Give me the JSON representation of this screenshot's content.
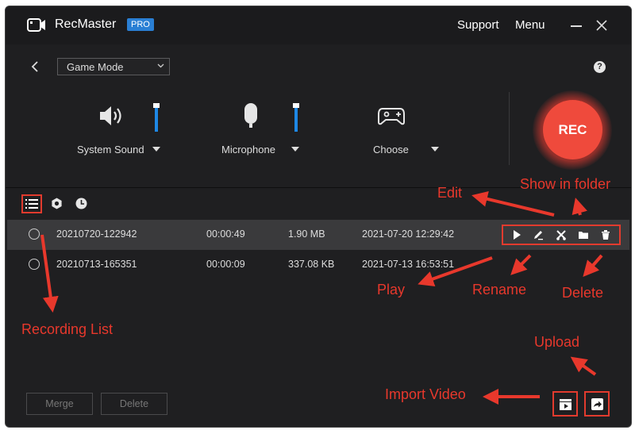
{
  "app": {
    "name": "RecMaster",
    "badge": "PRO"
  },
  "titlebar": {
    "support": "Support",
    "menu": "Menu"
  },
  "mode": {
    "selected": "Game Mode"
  },
  "sources": {
    "system_sound": "System Sound",
    "microphone": "Microphone",
    "choose": "Choose"
  },
  "rec_label": "REC",
  "recordings": [
    {
      "name": "20210720-122942",
      "duration": "00:00:49",
      "size": "1.90 MB",
      "date": "2021-07-20 12:29:42"
    },
    {
      "name": "20210713-165351",
      "duration": "00:00:09",
      "size": "337.08 KB",
      "date": "2021-07-13 16:53:51"
    }
  ],
  "buttons": {
    "merge": "Merge",
    "delete": "Delete"
  },
  "annotations": {
    "edit": "Edit",
    "show_in_folder": "Show in folder",
    "play": "Play",
    "rename": "Rename",
    "delete": "Delete",
    "recording_list": "Recording List",
    "upload": "Upload",
    "import_video": "Import Video"
  },
  "colors": {
    "accent": "#1e88e5",
    "rec": "#ef4a3c",
    "annotation": "#e8382c",
    "pro_badge": "#2a7fd4"
  }
}
